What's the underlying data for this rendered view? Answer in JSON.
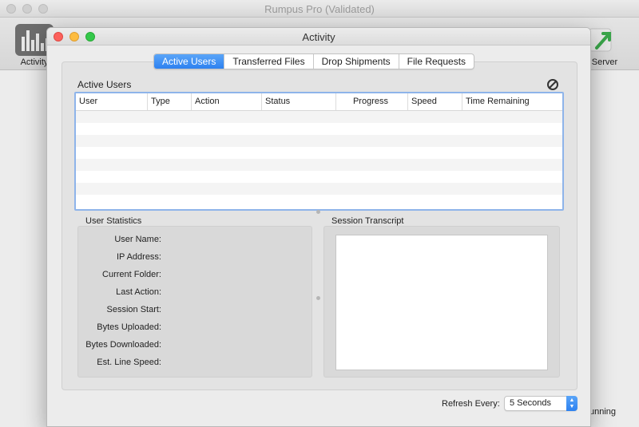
{
  "background": {
    "title": "Rumpus Pro (Validated)",
    "toolbar": {
      "activity_label": "Activity",
      "server_label": "Server"
    },
    "status_text": "unning"
  },
  "window": {
    "title": "Activity"
  },
  "tabs": [
    {
      "label": "Active Users",
      "active": true
    },
    {
      "label": "Transferred Files",
      "active": false
    },
    {
      "label": "Drop Shipments",
      "active": false
    },
    {
      "label": "File Requests",
      "active": false
    }
  ],
  "active_users": {
    "section_label": "Active Users",
    "columns": [
      "User",
      "Type",
      "Action",
      "Status",
      "Progress",
      "Speed",
      "Time Remaining"
    ],
    "rows": []
  },
  "user_statistics": {
    "label": "User Statistics",
    "fields": [
      "User Name:",
      "IP Address:",
      "Current Folder:",
      "Last Action:",
      "Session Start:",
      "Bytes Uploaded:",
      "Bytes Downloaded:",
      "Est. Line Speed:"
    ]
  },
  "session_transcript": {
    "label": "Session Transcript",
    "text": ""
  },
  "refresh": {
    "label": "Refresh Every:",
    "selected": "5 Seconds"
  },
  "colors": {
    "accent": "#2d81f0",
    "table_focus_border": "#8eb4ea"
  }
}
